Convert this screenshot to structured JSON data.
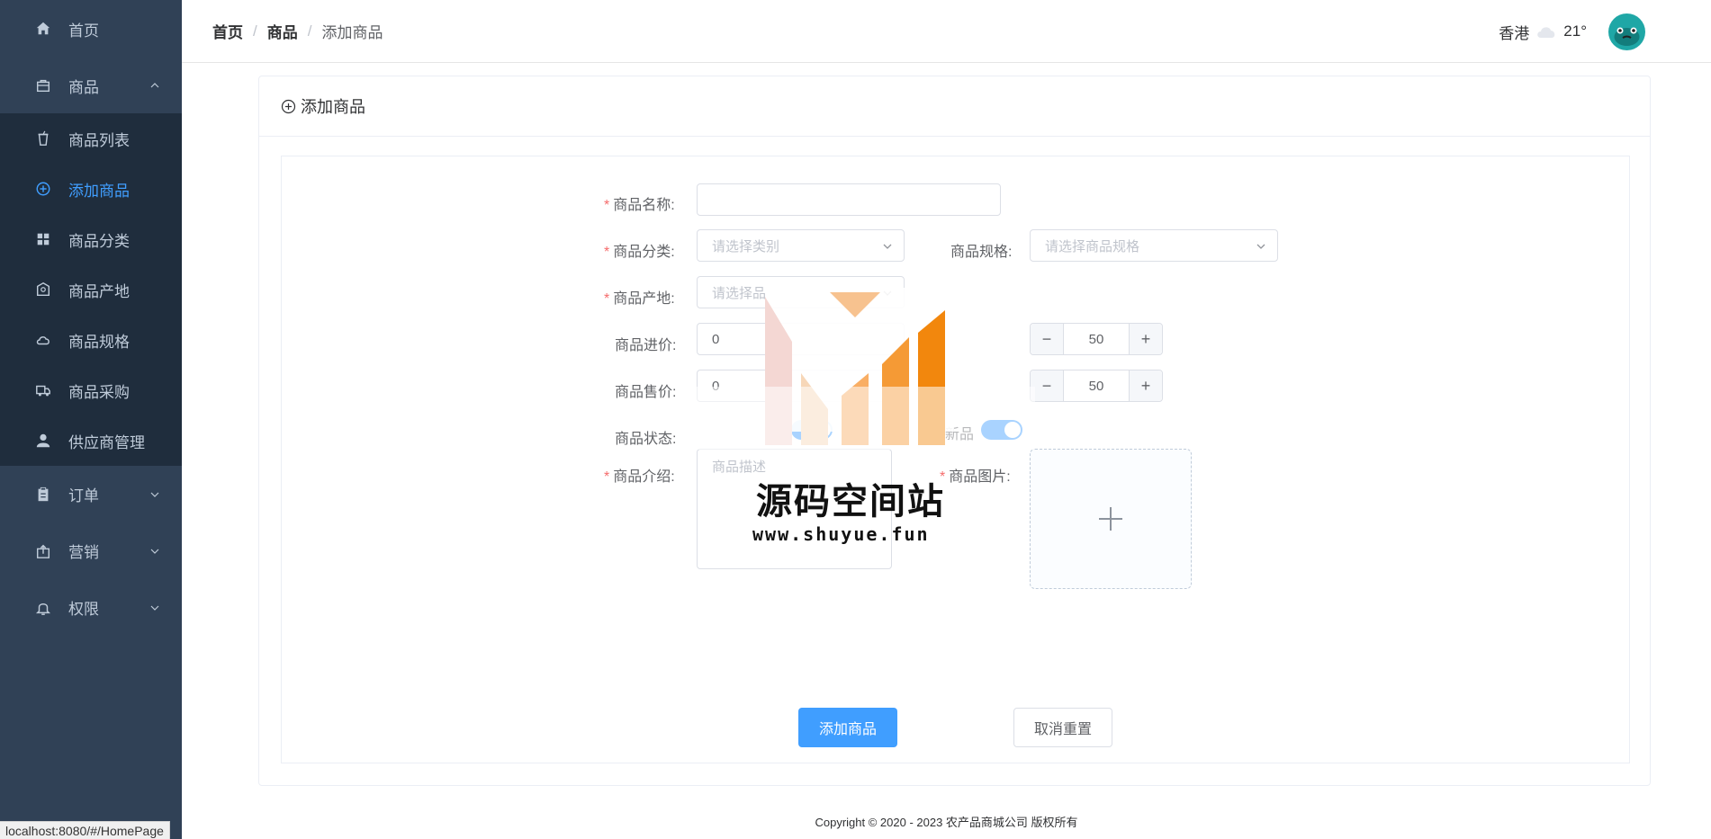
{
  "sidebar": {
    "home": "首页",
    "goods": "商品",
    "sub": [
      "商品列表",
      "添加商品",
      "商品分类",
      "商品产地",
      "商品规格",
      "商品采购",
      "供应商管理"
    ],
    "orders": "订单",
    "marketing": "营销",
    "permission": "权限",
    "active_index": 1
  },
  "breadcrumb": [
    "首页",
    "商品",
    "添加商品"
  ],
  "header": {
    "city": "香港",
    "temperature": "21°"
  },
  "card": {
    "title": "添加商品"
  },
  "form": {
    "name_label": "商品名称:",
    "category_label": "商品分类:",
    "category_placeholder": "请选择类别",
    "spec_label": "商品规格:",
    "spec_placeholder": "请选择商品规格",
    "origin_label": "商品产地:",
    "origin_placeholder": "请选择品",
    "cost_label": "商品进价:",
    "cost_value": "0",
    "stock_value": "50",
    "price_label": "商品售价:",
    "price_value": "0",
    "price_stock_value": "50",
    "status_label": "商品状态:",
    "new_label": "新品",
    "desc_label": "商品介绍:",
    "desc_placeholder": "商品描述",
    "image_label": "商品图片:",
    "submit": "添加商品",
    "reset": "取消重置"
  },
  "footer": "Copyright © 2020 - 2023  农产品商城公司 版权所有",
  "status_url": "localhost:8080/#/HomePage",
  "watermark": {
    "title": "源码空间站",
    "url": "www.shuyue.fun"
  },
  "colors": {
    "sidebar": "#304156",
    "submenu": "#1f2d3d",
    "accent": "#409eff",
    "required": "#f56c6c"
  }
}
